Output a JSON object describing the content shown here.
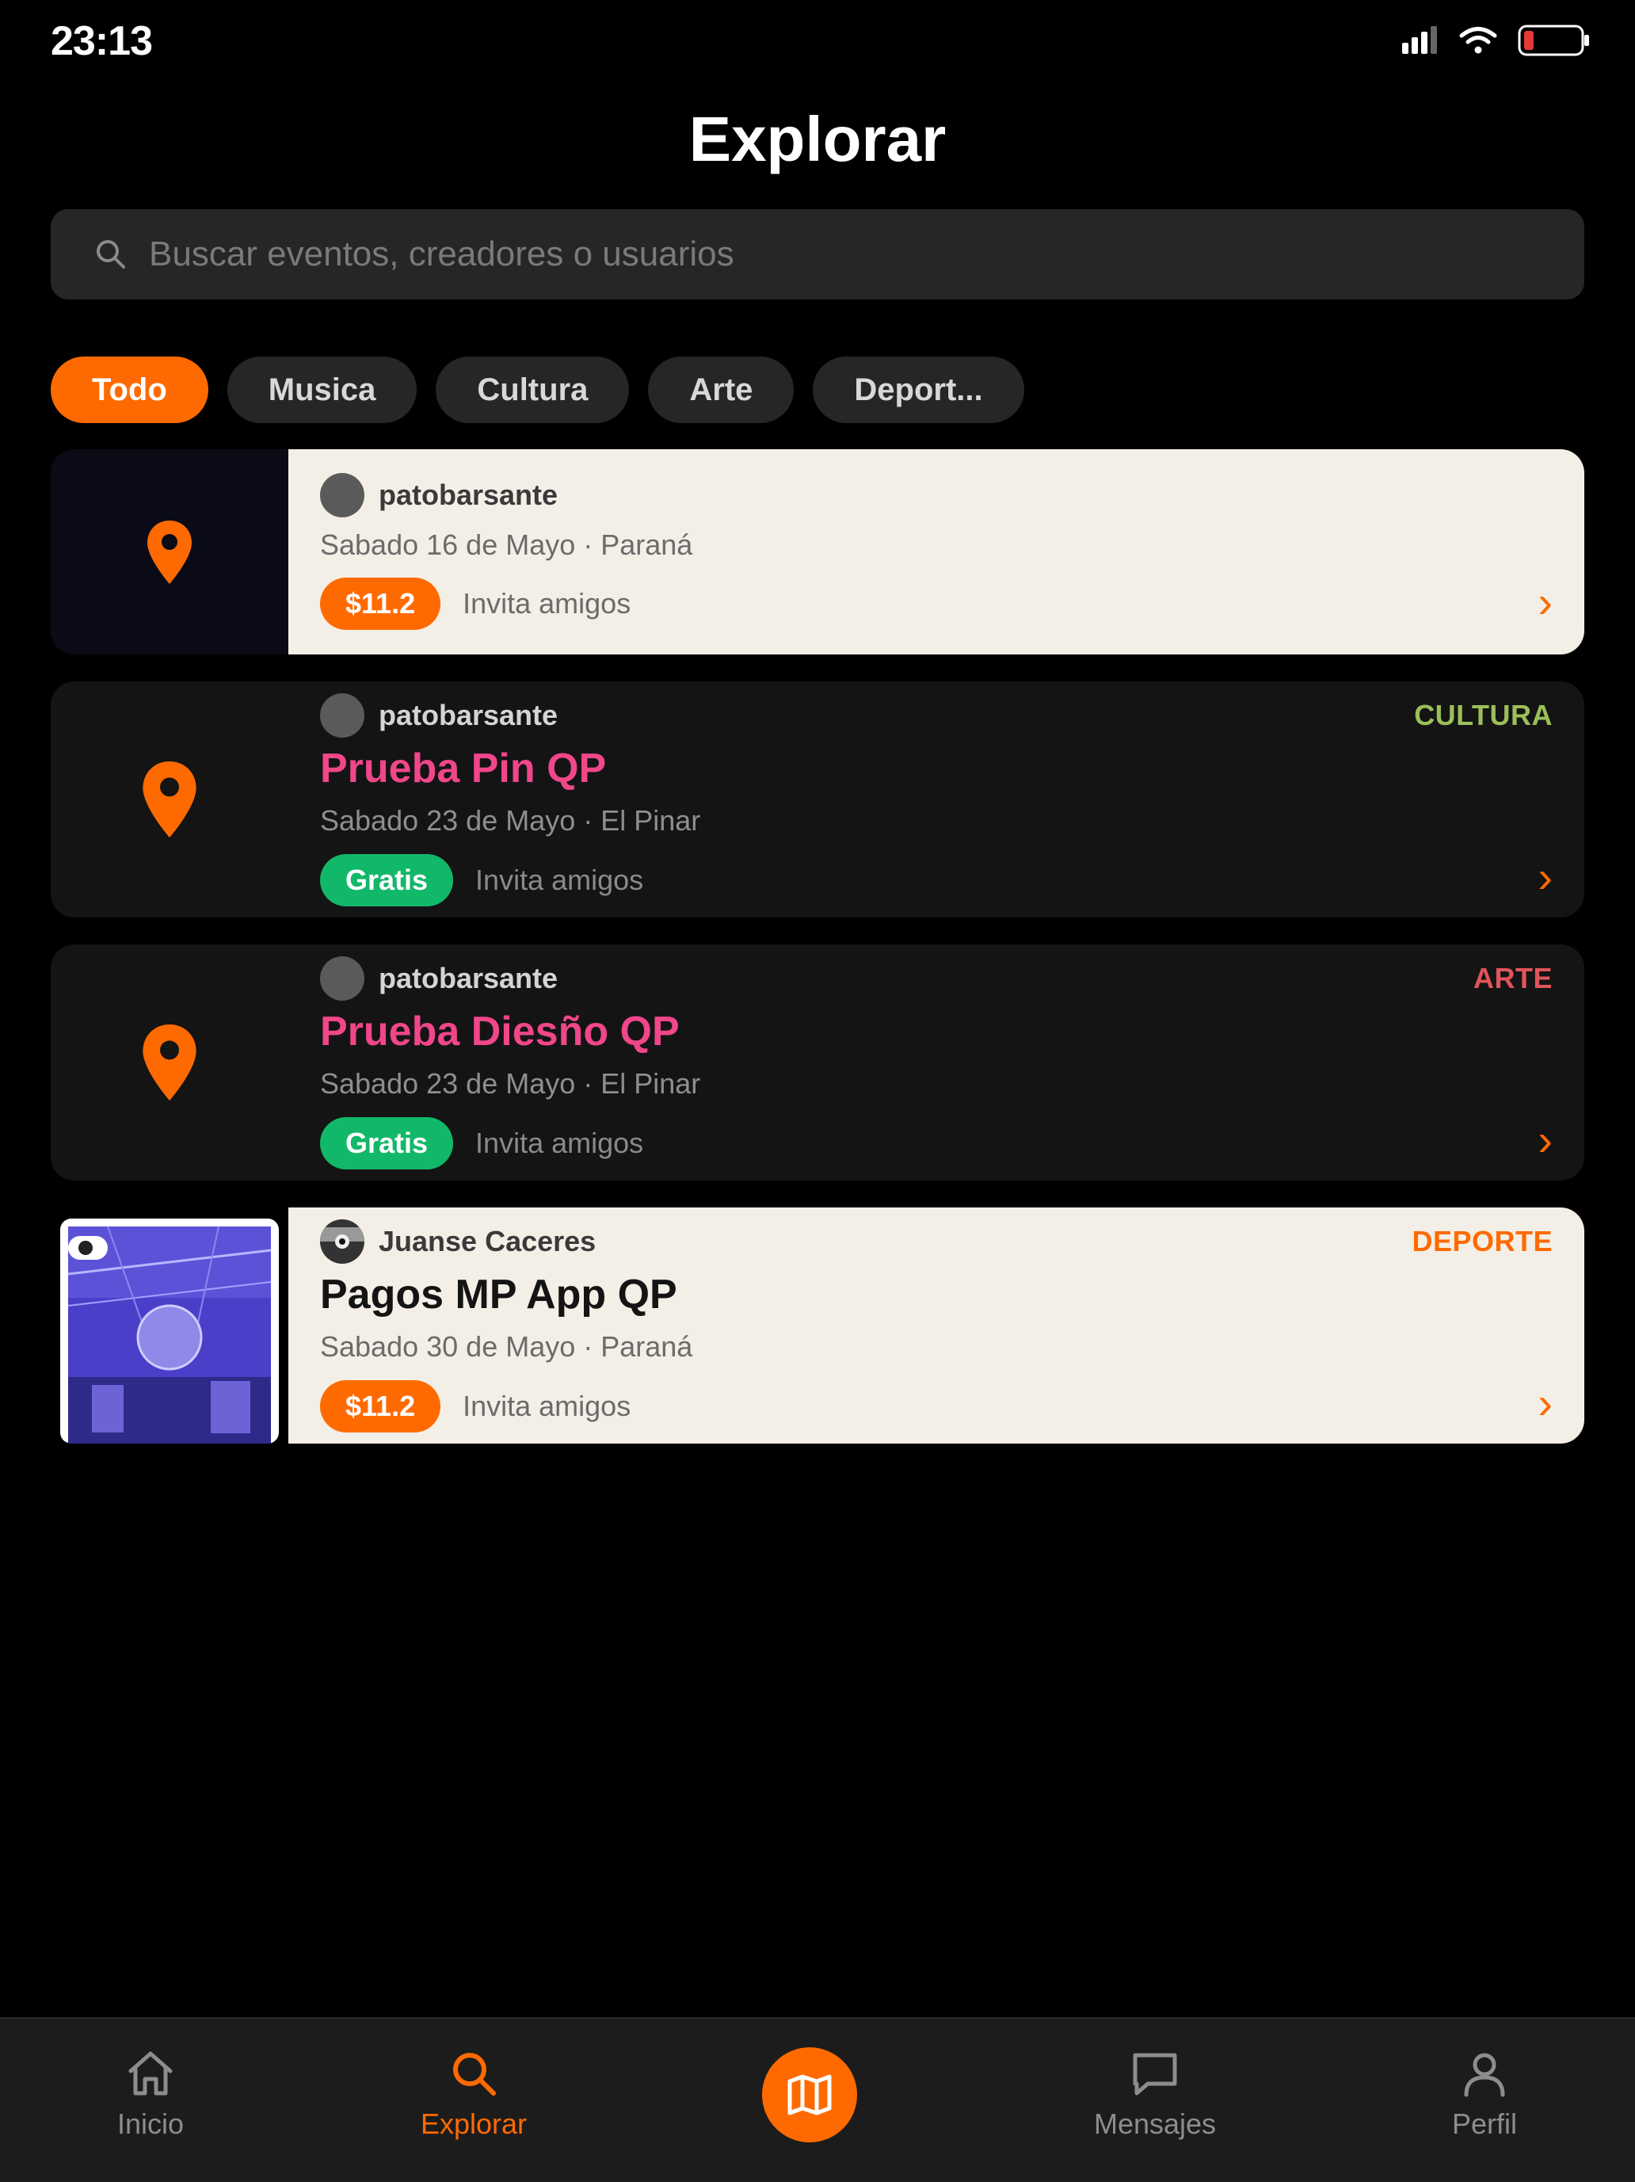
{
  "status_bar": {
    "time": "23:13"
  },
  "page": {
    "title": "Explorar"
  },
  "search": {
    "placeholder": "Buscar eventos, creadores o usuarios"
  },
  "filters": [
    "Todo",
    "Musica",
    "Cultura",
    "Arte",
    "Deport..."
  ],
  "events": [
    {
      "creator": "patobarsante",
      "category": "",
      "title": "",
      "date": "Sabado 16 de Mayo · Paraná",
      "price": "$11.2",
      "invite": "Invita amigos"
    },
    {
      "creator": "patobarsante",
      "category": "CULTURA",
      "category_color": "#9bbf5a",
      "title": "Prueba Pin QP",
      "date": "Sabado 23 de Mayo · El Pinar",
      "price": "Gratis",
      "invite": "Invita amigos"
    },
    {
      "creator": "patobarsante",
      "category": "ARTE",
      "category_color": "#e0555a",
      "title": "Prueba Diesño QP",
      "date": "Sabado 23 de Mayo · El Pinar",
      "price": "Gratis",
      "invite": "Invita amigos"
    },
    {
      "creator": "Juanse Caceres",
      "category": "DEPORTE",
      "category_color": "#ff6a00",
      "title": "Pagos MP App QP",
      "date": "Sabado 30 de Mayo · Paraná",
      "price": "$11.2",
      "invite": "Invita amigos"
    }
  ],
  "nav": {
    "inicio": "Inicio",
    "explorar": "Explorar",
    "mensajes": "Mensajes",
    "perfil": "Perfil"
  },
  "colors": {
    "accent": "#ff6a00",
    "free": "#12b86a",
    "title_pink": "#f0468a"
  }
}
